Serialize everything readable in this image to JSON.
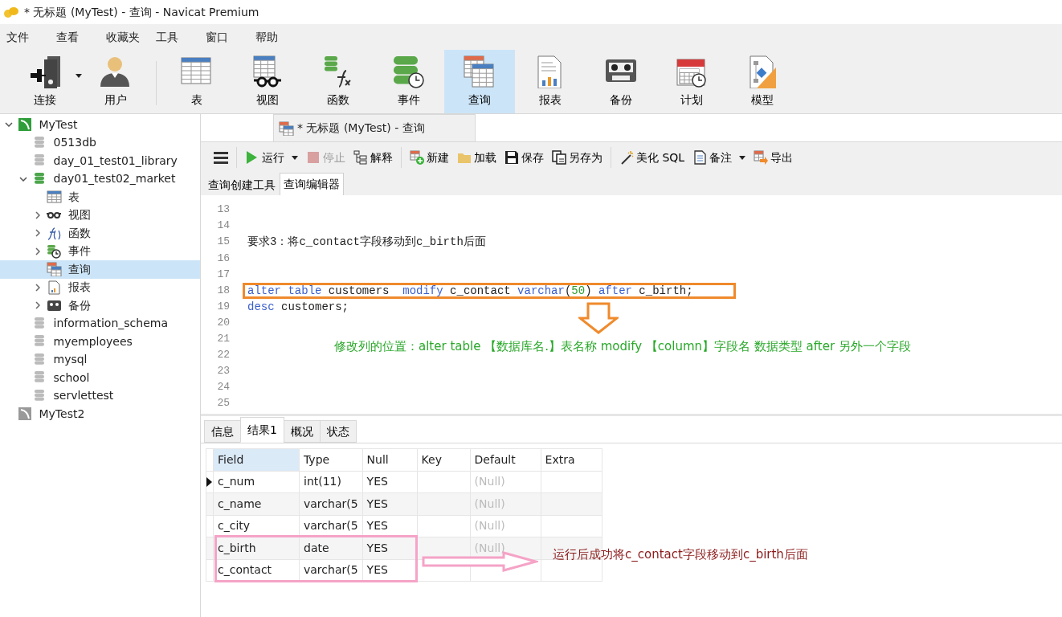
{
  "window": {
    "title": "* 无标题 (MyTest) - 查询 - Navicat Premium"
  },
  "menu": [
    "文件",
    "查看",
    "收藏夹",
    "工具",
    "窗口",
    "帮助"
  ],
  "toolbar_groups": [
    [
      {
        "label": "连接",
        "kind": "connect",
        "selected": false,
        "dropdown": true
      },
      {
        "label": "用户",
        "kind": "user",
        "selected": false,
        "dropdown": false
      }
    ],
    [
      {
        "label": "表",
        "kind": "table",
        "selected": false,
        "dropdown": false
      },
      {
        "label": "视图",
        "kind": "view",
        "selected": false,
        "dropdown": false
      },
      {
        "label": "函数",
        "kind": "function",
        "selected": false,
        "dropdown": false
      },
      {
        "label": "事件",
        "kind": "event",
        "selected": false,
        "dropdown": false
      },
      {
        "label": "查询",
        "kind": "query",
        "selected": true,
        "dropdown": false
      },
      {
        "label": "报表",
        "kind": "report",
        "selected": false,
        "dropdown": false
      },
      {
        "label": "备份",
        "kind": "backup",
        "selected": false,
        "dropdown": false
      },
      {
        "label": "计划",
        "kind": "schedule",
        "selected": false,
        "dropdown": false
      },
      {
        "label": "模型",
        "kind": "model",
        "selected": false,
        "dropdown": false
      }
    ]
  ],
  "sidebar": {
    "items": [
      {
        "label": "MyTest",
        "kind": "connection",
        "expandable": true,
        "expanded": true,
        "selected": false,
        "children": [
          {
            "label": "0513db",
            "kind": "database",
            "expandable": false,
            "selected": false
          },
          {
            "label": "day_01_test01_library",
            "kind": "database",
            "expandable": false,
            "selected": false
          },
          {
            "label": "day01_test02_market",
            "kind": "database-open",
            "expandable": true,
            "expanded": true,
            "selected": false,
            "children": [
              {
                "label": "表",
                "kind": "table",
                "expandable": false,
                "selected": false
              },
              {
                "label": "视图",
                "kind": "view",
                "expandable": true,
                "expanded": false,
                "selected": false
              },
              {
                "label": "函数",
                "kind": "function",
                "expandable": true,
                "expanded": false,
                "selected": false
              },
              {
                "label": "事件",
                "kind": "event",
                "expandable": true,
                "expanded": false,
                "selected": false
              },
              {
                "label": "查询",
                "kind": "query",
                "expandable": false,
                "selected": true
              },
              {
                "label": "报表",
                "kind": "report",
                "expandable": true,
                "expanded": false,
                "selected": false
              },
              {
                "label": "备份",
                "kind": "backup",
                "expandable": true,
                "expanded": false,
                "selected": false
              }
            ]
          },
          {
            "label": "information_schema",
            "kind": "database",
            "expandable": false,
            "selected": false
          },
          {
            "label": "myemployees",
            "kind": "database",
            "expandable": false,
            "selected": false
          },
          {
            "label": "mysql",
            "kind": "database",
            "expandable": false,
            "selected": false
          },
          {
            "label": "school",
            "kind": "database",
            "expandable": false,
            "selected": false
          },
          {
            "label": "servlettest",
            "kind": "database",
            "expandable": false,
            "selected": false
          }
        ]
      },
      {
        "label": "MyTest2",
        "kind": "connection-off",
        "expandable": false,
        "selected": false
      }
    ]
  },
  "document_tab": {
    "label": "* 无标题 (MyTest) - 查询"
  },
  "editor_toolbar_groups": [
    [
      {
        "label": "运行",
        "kind": "run",
        "disabled": false,
        "dropdown": true
      },
      {
        "label": "停止",
        "kind": "stop",
        "disabled": true,
        "dropdown": false
      },
      {
        "label": "解释",
        "kind": "explain",
        "disabled": false,
        "dropdown": false
      }
    ],
    [
      {
        "label": "新建",
        "kind": "new",
        "disabled": false,
        "dropdown": false
      },
      {
        "label": "加载",
        "kind": "load",
        "disabled": false,
        "dropdown": false
      },
      {
        "label": "保存",
        "kind": "save",
        "disabled": false,
        "dropdown": false
      },
      {
        "label": "另存为",
        "kind": "saveas",
        "disabled": false,
        "dropdown": false
      }
    ],
    [
      {
        "label": "美化 SQL",
        "kind": "beautify",
        "disabled": false,
        "dropdown": false
      },
      {
        "label": "备注",
        "kind": "note",
        "disabled": false,
        "dropdown": true
      },
      {
        "label": "导出",
        "kind": "export",
        "disabled": false,
        "dropdown": false
      }
    ]
  ],
  "editor_tabs": [
    {
      "label": "查询创建工具",
      "selected": false
    },
    {
      "label": "查询编辑器",
      "selected": true
    }
  ],
  "editor": {
    "lines": [
      {
        "number": "13",
        "boxed": false
      },
      {
        "number": "14",
        "boxed": false
      },
      {
        "number": "15",
        "boxed": false,
        "tokens": [
          {
            "text": "要求3：将c_contact字段移动到c_birth后面",
            "kind": "plain"
          }
        ]
      },
      {
        "number": "16",
        "boxed": false
      },
      {
        "number": "17",
        "boxed": false
      },
      {
        "number": "18",
        "boxed": true,
        "tokens": [
          {
            "text": "alter ",
            "kind": "keyword"
          },
          {
            "text": "table",
            "kind": "keyword"
          },
          {
            "text": " customers  ",
            "kind": "plain"
          },
          {
            "text": "modify",
            "kind": "keyword"
          },
          {
            "text": " c_contact ",
            "kind": "plain"
          },
          {
            "text": "varchar",
            "kind": "keyword"
          },
          {
            "text": "(",
            "kind": "plain"
          },
          {
            "text": "50",
            "kind": "number"
          },
          {
            "text": ") ",
            "kind": "plain"
          },
          {
            "text": "after",
            "kind": "keyword"
          },
          {
            "text": " c_birth;",
            "kind": "plain"
          }
        ]
      },
      {
        "number": "19",
        "boxed": false,
        "tokens": [
          {
            "text": "desc",
            "kind": "keyword"
          },
          {
            "text": " customers;",
            "kind": "plain"
          }
        ]
      },
      {
        "number": "20",
        "boxed": false
      },
      {
        "number": "21",
        "boxed": false
      },
      {
        "number": "22",
        "boxed": false
      },
      {
        "number": "23",
        "boxed": false
      },
      {
        "number": "24",
        "boxed": false
      },
      {
        "number": "25",
        "boxed": false
      }
    ],
    "annotation": "修改列的位置：alter   table 【数据库名.】表名称  modify  【column】字段名  数据类型 after  另外一个字段"
  },
  "result_tabs": [
    {
      "label": "信息",
      "selected": false
    },
    {
      "label": "结果1",
      "selected": true
    },
    {
      "label": "概况",
      "selected": false
    },
    {
      "label": "状态",
      "selected": false
    }
  ],
  "result_table": {
    "columns": [
      {
        "label": "Field",
        "selected": true
      },
      {
        "label": "Type",
        "selected": false
      },
      {
        "label": "Null",
        "selected": false
      },
      {
        "label": "Key",
        "selected": false
      },
      {
        "label": "Default",
        "selected": false
      },
      {
        "label": "Extra",
        "selected": false
      }
    ],
    "rows": [
      {
        "selected": true,
        "boxed": false,
        "cells": [
          "c_num",
          "int(11)",
          "YES",
          null,
          "(Null)",
          null
        ]
      },
      {
        "selected": false,
        "boxed": false,
        "cells": [
          "c_name",
          "varchar(5",
          "YES",
          null,
          "(Null)",
          null
        ]
      },
      {
        "selected": false,
        "boxed": false,
        "cells": [
          "c_city",
          "varchar(5",
          "YES",
          null,
          "(Null)",
          null
        ]
      },
      {
        "selected": false,
        "boxed": true,
        "cells": [
          "c_birth",
          "date",
          "YES",
          null,
          "(Null)",
          null
        ]
      },
      {
        "selected": false,
        "boxed": true,
        "cells": [
          "c_contact",
          "varchar(5",
          "YES",
          null,
          null,
          null
        ]
      }
    ]
  },
  "result_note": "运行后成功将c_contact字段移动到c_birth后面"
}
